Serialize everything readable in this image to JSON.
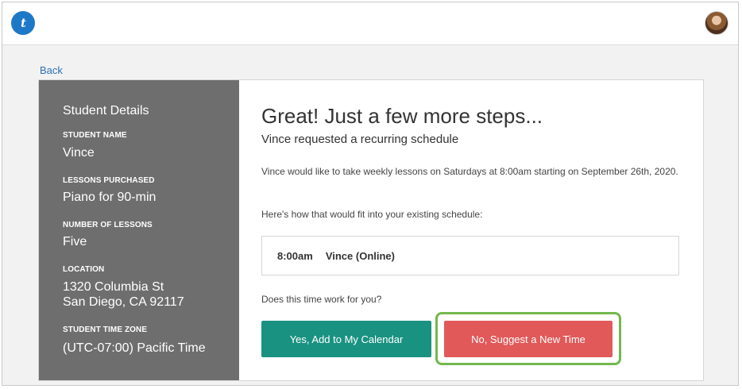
{
  "header": {
    "logo_text": "t",
    "avatar_alt": "user-avatar"
  },
  "nav": {
    "back_label": "Back"
  },
  "sidebar": {
    "title": "Student Details",
    "fields": [
      {
        "label": "STUDENT NAME",
        "value": "Vince"
      },
      {
        "label": "LESSONS PURCHASED",
        "value": "Piano for 90-min"
      },
      {
        "label": "NUMBER OF LESSONS",
        "value": "Five"
      },
      {
        "label": "LOCATION",
        "value_line1": "1320 Columbia St",
        "value_line2": "San Diego, CA 92117"
      },
      {
        "label": "STUDENT TIME ZONE",
        "value": "(UTC-07:00) Pacific Time"
      }
    ]
  },
  "main": {
    "headline": "Great! Just a few more steps...",
    "subhead": "Vince requested a recurring schedule",
    "description": "Vince would like to take weekly lessons on Saturdays at 8:00am starting on September 26th, 2020.",
    "fit_text": "Here's how that would fit into your existing schedule:",
    "slot": {
      "time": "8:00am",
      "name": "Vince (Online)"
    },
    "question": "Does this time work for you?",
    "yes_button": "Yes, Add to My Calendar",
    "no_button": "No, Suggest a New Time"
  },
  "colors": {
    "sidebar_bg": "#6e6e6e",
    "yes_button": "#1a9281",
    "no_button": "#e15959",
    "highlight": "#73b84e",
    "link": "#2d6fb0"
  }
}
